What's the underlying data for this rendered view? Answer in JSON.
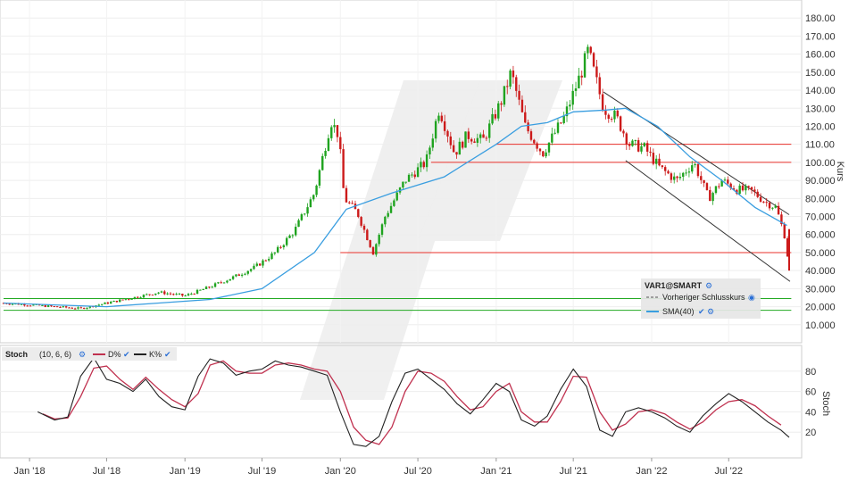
{
  "chart_data": [
    {
      "type": "candlestick",
      "symbol": "VAR1@SMART",
      "ylabel": "Kurs",
      "ylim": [
        0,
        190
      ],
      "y_ticks": [
        "10.000",
        "20.000",
        "30.000",
        "40.000",
        "50.000",
        "60.000",
        "70.000",
        "80.000",
        "90.000",
        "100.00",
        "110.00",
        "120.00",
        "130.00",
        "140.00",
        "150.00",
        "160.00",
        "170.00",
        "180.00"
      ],
      "y_tick_values": [
        10,
        20,
        30,
        40,
        50,
        60,
        70,
        80,
        90,
        100,
        110,
        120,
        130,
        140,
        150,
        160,
        170,
        180
      ],
      "x_ticks": [
        "Jan '18",
        "Jul '18",
        "Jan '19",
        "Jul '19",
        "Jan '20",
        "Jul '20",
        "Jan '21",
        "Jul '21",
        "Jan '22",
        "Jul '22"
      ],
      "x_tick_dates": [
        "2018-01-01",
        "2018-07-01",
        "2019-01-01",
        "2019-07-01",
        "2020-01-01",
        "2020-07-01",
        "2021-01-01",
        "2021-07-01",
        "2022-01-01",
        "2022-07-01"
      ],
      "date_range": [
        "2017-11-01",
        "2022-11-20"
      ],
      "price_series": {
        "dates": [
          "2017-11-01",
          "2018-01-01",
          "2018-03-01",
          "2018-05-01",
          "2018-07-01",
          "2018-09-01",
          "2018-11-01",
          "2019-01-01",
          "2019-03-01",
          "2019-05-01",
          "2019-06-15",
          "2019-08-01",
          "2019-09-15",
          "2019-11-01",
          "2019-12-10",
          "2019-12-28",
          "2020-01-10",
          "2020-02-10",
          "2020-03-18",
          "2020-04-15",
          "2020-06-01",
          "2020-07-20",
          "2020-08-20",
          "2020-09-25",
          "2020-10-25",
          "2020-12-01",
          "2021-01-15",
          "2021-02-05",
          "2021-03-10",
          "2021-04-20",
          "2021-06-10",
          "2021-07-20",
          "2021-08-05",
          "2021-09-10",
          "2021-10-10",
          "2021-11-10",
          "2021-12-15",
          "2022-01-20",
          "2022-03-01",
          "2022-04-10",
          "2022-05-15",
          "2022-06-15",
          "2022-07-20",
          "2022-08-25",
          "2022-09-25",
          "2022-10-20",
          "2022-11-05",
          "2022-11-12",
          "2022-11-20"
        ],
        "values": [
          22,
          21,
          20,
          19,
          22,
          25,
          28,
          26,
          31,
          37,
          42,
          50,
          62,
          83,
          123,
          115,
          80,
          72,
          50,
          70,
          90,
          100,
          130,
          105,
          115,
          112,
          135,
          150,
          120,
          105,
          125,
          150,
          162,
          130,
          125,
          110,
          108,
          97,
          90,
          100,
          80,
          90,
          85,
          84,
          78,
          75,
          63,
          57,
          40
        ]
      },
      "sma": {
        "name": "SMA(40)",
        "dates": [
          "2017-11-01",
          "2018-03-01",
          "2018-07-01",
          "2018-11-01",
          "2019-03-01",
          "2019-07-01",
          "2019-11-01",
          "2020-01-15",
          "2020-05-01",
          "2020-09-01",
          "2021-01-01",
          "2021-03-01",
          "2021-05-01",
          "2021-07-01",
          "2021-09-15",
          "2021-11-01",
          "2022-01-15",
          "2022-04-01",
          "2022-06-15",
          "2022-09-01",
          "2022-11-15"
        ],
        "values": [
          22,
          21,
          20,
          22,
          24,
          30,
          50,
          74,
          83,
          92,
          110,
          120,
          122,
          128,
          129,
          130,
          120,
          103,
          90,
          75,
          65
        ]
      },
      "horizontal_lines": [
        {
          "value": 110,
          "color": "#e8302b",
          "from": "2021-01-01",
          "to": "2022-11-25"
        },
        {
          "value": 100,
          "color": "#e8302b",
          "from": "2020-08-01",
          "to": "2022-11-25"
        },
        {
          "value": 50,
          "color": "#e8302b",
          "from": "2020-01-01",
          "to": "2022-11-25"
        },
        {
          "value": 24.5,
          "color": "#22aa22",
          "from": "2017-11-01",
          "to": "2022-11-25"
        },
        {
          "value": 18,
          "color": "#22aa22",
          "from": "2017-11-01",
          "to": "2022-11-25"
        }
      ],
      "trend_channel": [
        {
          "x1": "2021-09-10",
          "y1": 139,
          "x2": "2022-11-20",
          "y2": 71
        },
        {
          "x1": "2021-11-01",
          "y1": 101,
          "x2": "2022-11-22",
          "y2": 34
        }
      ],
      "legend": {
        "title": "VAR1@SMART",
        "items": [
          "Vorheriger Schlusskurs",
          "SMA(40)"
        ]
      },
      "colors": {
        "up": "#1fa31f",
        "down": "#cc1a1a",
        "sma": "#3a9ee0"
      }
    },
    {
      "type": "line",
      "title": "Stoch",
      "params": "(10, 6, 6)",
      "ylabel": "Stoch",
      "ylim": [
        0,
        100
      ],
      "y_ticks": [
        "20",
        "40",
        "60",
        "80"
      ],
      "y_tick_values": [
        20,
        40,
        60,
        80
      ],
      "series": [
        {
          "name": "D%",
          "color": "#c0314f",
          "dates": [
            "2018-02-01",
            "2018-03-01",
            "2018-04-01",
            "2018-05-01",
            "2018-06-01",
            "2018-07-01",
            "2018-08-01",
            "2018-09-01",
            "2018-10-01",
            "2018-11-01",
            "2018-12-01",
            "2019-01-01",
            "2019-02-01",
            "2019-03-01",
            "2019-04-01",
            "2019-05-01",
            "2019-06-01",
            "2019-07-01",
            "2019-08-01",
            "2019-09-01",
            "2019-10-01",
            "2019-11-01",
            "2019-12-01",
            "2020-01-01",
            "2020-02-01",
            "2020-03-01",
            "2020-04-01",
            "2020-05-01",
            "2020-06-01",
            "2020-07-01",
            "2020-08-01",
            "2020-09-01",
            "2020-10-01",
            "2020-11-01",
            "2020-12-01",
            "2021-01-01",
            "2021-02-01",
            "2021-03-01",
            "2021-04-01",
            "2021-05-01",
            "2021-06-01",
            "2021-07-01",
            "2021-08-01",
            "2021-09-01",
            "2021-10-01",
            "2021-11-01",
            "2021-12-01",
            "2022-01-01",
            "2022-02-01",
            "2022-03-01",
            "2022-04-01",
            "2022-05-01",
            "2022-06-01",
            "2022-07-01",
            "2022-08-01",
            "2022-09-01",
            "2022-10-01",
            "2022-11-01"
          ],
          "values": [
            38,
            33,
            34,
            55,
            83,
            85,
            72,
            62,
            74,
            62,
            52,
            45,
            58,
            86,
            90,
            80,
            78,
            78,
            86,
            88,
            86,
            82,
            80,
            60,
            25,
            12,
            8,
            25,
            60,
            80,
            78,
            70,
            55,
            42,
            45,
            60,
            68,
            40,
            30,
            30,
            50,
            75,
            74,
            40,
            22,
            28,
            40,
            42,
            38,
            30,
            23,
            30,
            42,
            50,
            52,
            46,
            36,
            27
          ]
        },
        {
          "name": "K%",
          "color": "#222222",
          "dates": [
            "2018-01-20",
            "2018-03-01",
            "2018-04-01",
            "2018-05-01",
            "2018-06-01",
            "2018-07-01",
            "2018-08-01",
            "2018-09-01",
            "2018-10-01",
            "2018-11-01",
            "2018-12-01",
            "2019-01-01",
            "2019-02-01",
            "2019-03-01",
            "2019-04-01",
            "2019-05-01",
            "2019-06-01",
            "2019-07-01",
            "2019-08-01",
            "2019-09-01",
            "2019-10-01",
            "2019-11-01",
            "2019-12-01",
            "2020-01-01",
            "2020-02-01",
            "2020-03-01",
            "2020-04-01",
            "2020-05-01",
            "2020-06-01",
            "2020-07-01",
            "2020-08-01",
            "2020-09-01",
            "2020-10-01",
            "2020-11-01",
            "2020-12-01",
            "2021-01-01",
            "2021-02-01",
            "2021-03-01",
            "2021-04-01",
            "2021-05-01",
            "2021-06-01",
            "2021-07-01",
            "2021-08-01",
            "2021-09-01",
            "2021-10-01",
            "2021-11-01",
            "2021-12-01",
            "2022-01-01",
            "2022-02-01",
            "2022-03-01",
            "2022-04-01",
            "2022-05-01",
            "2022-06-01",
            "2022-07-01",
            "2022-08-01",
            "2022-09-01",
            "2022-10-01",
            "2022-11-01",
            "2022-11-20"
          ],
          "values": [
            40,
            32,
            35,
            75,
            93,
            72,
            68,
            60,
            72,
            55,
            45,
            42,
            75,
            92,
            88,
            76,
            80,
            82,
            90,
            86,
            84,
            80,
            76,
            40,
            8,
            6,
            16,
            50,
            78,
            82,
            72,
            62,
            48,
            38,
            52,
            68,
            60,
            32,
            26,
            36,
            62,
            82,
            65,
            22,
            16,
            40,
            44,
            40,
            34,
            26,
            20,
            36,
            48,
            58,
            50,
            40,
            30,
            22,
            15
          ]
        }
      ]
    }
  ]
}
